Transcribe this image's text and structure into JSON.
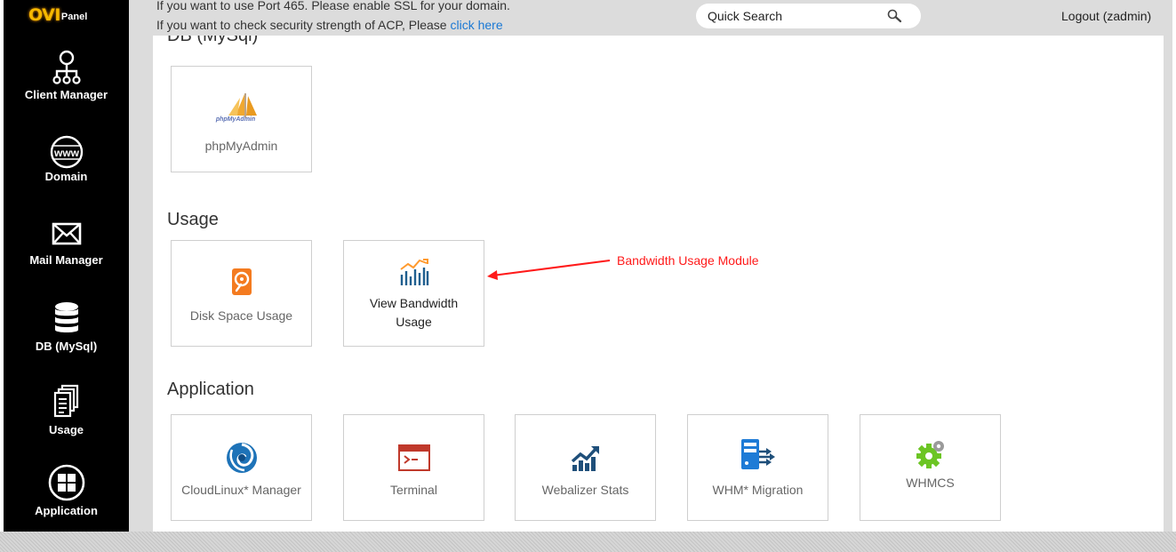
{
  "brand": {
    "logo_main": "OVI",
    "logo_sub": "Panel"
  },
  "sidebar": {
    "items": [
      {
        "label": "Client Manager",
        "icon": "sitemap-icon"
      },
      {
        "label": "Domain",
        "icon": "www-globe-icon"
      },
      {
        "label": "Mail Manager",
        "icon": "envelope-icon"
      },
      {
        "label": "DB (MySql)",
        "icon": "database-icon"
      },
      {
        "label": "Usage",
        "icon": "documents-icon"
      },
      {
        "label": "Application",
        "icon": "grid-circle-icon"
      }
    ]
  },
  "notice": {
    "line1": "If you want to use Port 465. Please enable SSL for your domain.",
    "line2_prefix": "If you want to check security strength of ACP, Please ",
    "line2_link": "click here"
  },
  "search": {
    "placeholder": "Quick Search"
  },
  "header": {
    "logout_label": "Logout (zadmin)"
  },
  "sections": {
    "db": {
      "title": "DB (MySql)",
      "tiles": [
        {
          "label": "phpMyAdmin",
          "icon": "phpmyadmin-sail-icon"
        }
      ]
    },
    "usage": {
      "title": "Usage",
      "tiles": [
        {
          "label": "Disk Space Usage",
          "icon": "hard-disk-icon"
        },
        {
          "label": "View Bandwidth Usage",
          "icon": "bandwidth-chart-icon"
        }
      ]
    },
    "application": {
      "title": "Application",
      "tiles": [
        {
          "label": "CloudLinux* Manager",
          "icon": "cloudlinux-icon"
        },
        {
          "label": "Terminal",
          "icon": "terminal-icon"
        },
        {
          "label": "Webalizer Stats",
          "icon": "stats-chart-icon"
        },
        {
          "label": "WHM* Migration",
          "icon": "migration-icon"
        },
        {
          "label": "WHMCS",
          "icon": "gear-icon"
        }
      ]
    }
  },
  "annotation": {
    "text": "Bandwidth Usage Module",
    "color": "#ff1a1a"
  },
  "colors": {
    "sidebar_bg": "#000000",
    "link": "#1a78d4",
    "logo": "#f5b800"
  }
}
